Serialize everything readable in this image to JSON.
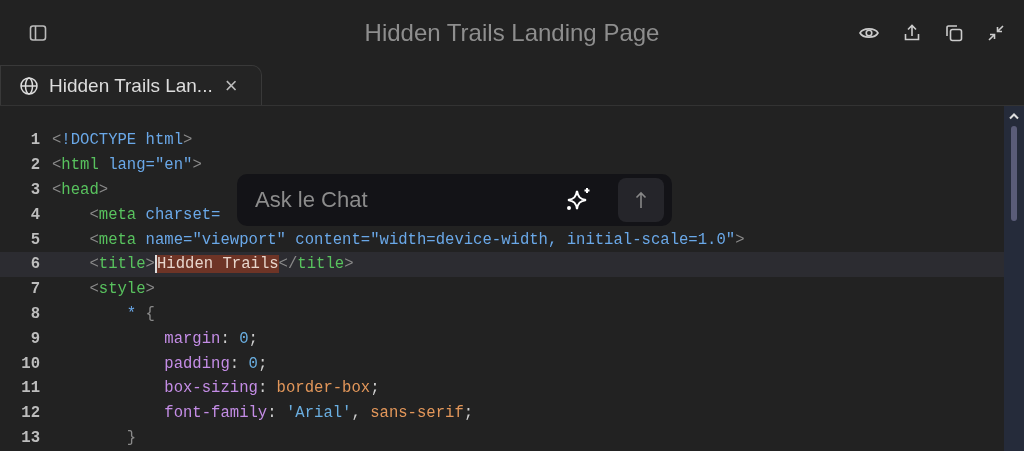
{
  "window": {
    "title": "Hidden Trails Landing Page"
  },
  "tabs": [
    {
      "label": "Hidden Trails Lan...",
      "selected": true,
      "close": "×"
    }
  ],
  "editor": {
    "lines": [
      {
        "number": "1",
        "current": false,
        "tokens": [
          {
            "kind": "punct",
            "text": "<"
          },
          {
            "kind": "attr",
            "text": "!DOCTYPE html"
          },
          {
            "kind": "punct",
            "text": ">"
          }
        ]
      },
      {
        "number": "2",
        "current": false,
        "tokens": [
          {
            "kind": "punct",
            "text": "<"
          },
          {
            "kind": "tag",
            "text": "html"
          },
          {
            "kind": "attr",
            "text": " lang=\"en\""
          },
          {
            "kind": "punct",
            "text": ">"
          }
        ]
      },
      {
        "number": "3",
        "current": false,
        "tokens": [
          {
            "kind": "punct",
            "text": "<"
          },
          {
            "kind": "tag",
            "text": "head"
          },
          {
            "kind": "punct",
            "text": ">"
          }
        ]
      },
      {
        "number": "4",
        "current": false,
        "tokens": [
          {
            "kind": "punct",
            "text": "    <"
          },
          {
            "kind": "tag",
            "text": "meta"
          },
          {
            "kind": "attr",
            "text": " charset="
          }
        ]
      },
      {
        "number": "5",
        "current": false,
        "tokens": [
          {
            "kind": "punct",
            "text": "    <"
          },
          {
            "kind": "tag",
            "text": "meta"
          },
          {
            "kind": "attr",
            "text": " name=\"viewport\" content=\"width=device-width, initial-scale=1.0\""
          },
          {
            "kind": "punct",
            "text": ">"
          }
        ]
      },
      {
        "number": "6",
        "current": true,
        "tokens": [
          {
            "kind": "punct",
            "text": "    <"
          },
          {
            "kind": "tag",
            "text": "title"
          },
          {
            "kind": "punct",
            "text": ">"
          },
          {
            "kind": "selected",
            "text": "Hidden Trails"
          },
          {
            "kind": "punct",
            "text": "</"
          },
          {
            "kind": "tag",
            "text": "title"
          },
          {
            "kind": "punct",
            "text": ">"
          }
        ]
      },
      {
        "number": "7",
        "current": false,
        "tokens": [
          {
            "kind": "punct",
            "text": "    <"
          },
          {
            "kind": "tag",
            "text": "style"
          },
          {
            "kind": "punct",
            "text": ">"
          }
        ]
      },
      {
        "number": "8",
        "current": false,
        "tokens": [
          {
            "kind": "attr",
            "text": "        *"
          },
          {
            "kind": "punct",
            "text": " {"
          }
        ]
      },
      {
        "number": "9",
        "current": false,
        "tokens": [
          {
            "kind": "prop",
            "text": "            margin"
          },
          {
            "kind": "text",
            "text": ":"
          },
          {
            "kind": "number",
            "text": " 0"
          },
          {
            "kind": "text",
            "text": ";"
          }
        ]
      },
      {
        "number": "10",
        "current": false,
        "tokens": [
          {
            "kind": "prop",
            "text": "            padding"
          },
          {
            "kind": "text",
            "text": ":"
          },
          {
            "kind": "number",
            "text": " 0"
          },
          {
            "kind": "text",
            "text": ";"
          }
        ]
      },
      {
        "number": "11",
        "current": false,
        "tokens": [
          {
            "kind": "prop",
            "text": "            box-sizing"
          },
          {
            "kind": "text",
            "text": ":"
          },
          {
            "kind": "value",
            "text": " border-box"
          },
          {
            "kind": "text",
            "text": ";"
          }
        ]
      },
      {
        "number": "12",
        "current": false,
        "tokens": [
          {
            "kind": "prop",
            "text": "            font-family"
          },
          {
            "kind": "text",
            "text": ":"
          },
          {
            "kind": "number",
            "text": " 'Arial'"
          },
          {
            "kind": "text",
            "text": ","
          },
          {
            "kind": "value",
            "text": " sans-serif"
          },
          {
            "kind": "text",
            "text": ";"
          }
        ]
      },
      {
        "number": "13",
        "current": false,
        "tokens": [
          {
            "kind": "punct",
            "text": "        }"
          }
        ]
      }
    ]
  },
  "chat": {
    "placeholder": "Ask le Chat"
  }
}
